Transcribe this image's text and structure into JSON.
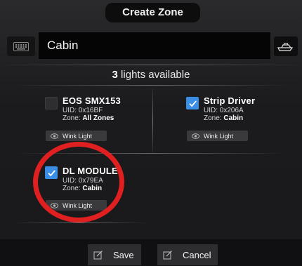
{
  "header": {
    "title": "Create Zone"
  },
  "name_row": {
    "keyboard_icon": "keyboard-icon",
    "zone_name": "Cabin",
    "boat_icon": "boat-icon"
  },
  "summary": {
    "count": "3",
    "text": " lights available"
  },
  "lights": [
    {
      "name": "EOS SMX153",
      "uid_label": "UID: ",
      "uid": "0x16BF",
      "zone_label": "Zone: ",
      "zone": "All Zones",
      "checked": false,
      "wink": "Wink Light"
    },
    {
      "name": "Strip Driver",
      "uid_label": "UID: ",
      "uid": "0x206A",
      "zone_label": "Zone: ",
      "zone": "Cabin",
      "checked": true,
      "wink": "Wink Light"
    },
    {
      "name": "DL MODULE",
      "uid_label": "UID: ",
      "uid": "0x79EA",
      "zone_label": "Zone: ",
      "zone": "Cabin",
      "checked": true,
      "wink": "Wink Light"
    }
  ],
  "footer": {
    "save_label": "Save",
    "cancel_label": "Cancel"
  },
  "colors": {
    "accent": "#3a8ee6",
    "annotation": "#e02020",
    "background": "#1c1c1e"
  }
}
